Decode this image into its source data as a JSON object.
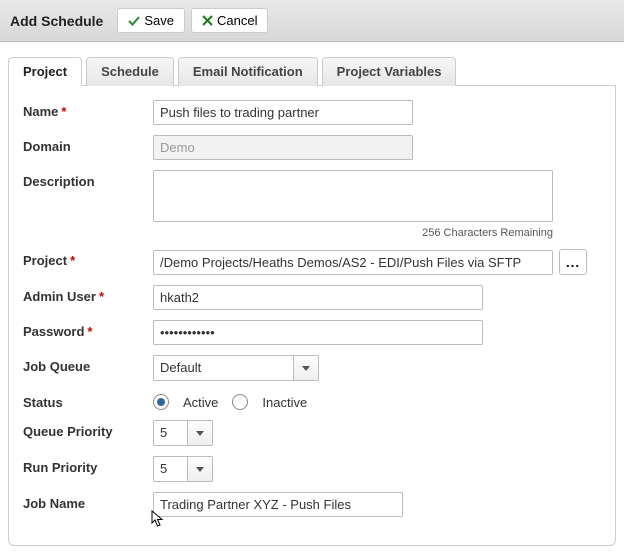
{
  "header": {
    "title": "Add Schedule",
    "save_label": "Save",
    "cancel_label": "Cancel"
  },
  "tabs": {
    "project": "Project",
    "schedule": "Schedule",
    "email": "Email Notification",
    "vars": "Project Variables"
  },
  "labels": {
    "name": "Name",
    "domain": "Domain",
    "description": "Description",
    "project": "Project",
    "admin_user": "Admin User",
    "password": "Password",
    "job_queue": "Job Queue",
    "status": "Status",
    "queue_priority": "Queue Priority",
    "run_priority": "Run Priority",
    "job_name": "Job Name"
  },
  "values": {
    "name": "Push files to trading partner",
    "domain": "Demo",
    "description": "",
    "char_remaining": "256 Characters Remaining",
    "project": "/Demo Projects/Heaths Demos/AS2 - EDI/Push Files via SFTP",
    "admin_user": "hkath2",
    "password": "••••••••••••",
    "job_queue": "Default",
    "status_active": "Active",
    "status_inactive": "Inactive",
    "status_selected": "active",
    "queue_priority": "5",
    "run_priority": "5",
    "job_name": "Trading Partner XYZ - Push Files"
  },
  "icons": {
    "browse": "..."
  }
}
